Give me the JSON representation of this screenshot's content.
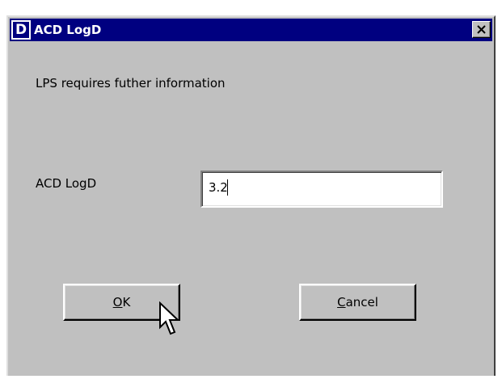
{
  "window": {
    "title": "ACD LogD",
    "app_icon_letter": "D",
    "close_glyph": "close-icon"
  },
  "dialog": {
    "prompt": "LPS requires futher information",
    "field_label": "ACD LogD",
    "field_value": "3.2"
  },
  "buttons": {
    "ok": {
      "mnemonic": "O",
      "rest": "K"
    },
    "cancel": {
      "mnemonic": "C",
      "rest": "ancel"
    }
  },
  "colors": {
    "titlebar": "#000080",
    "face": "#c0c0c0"
  }
}
